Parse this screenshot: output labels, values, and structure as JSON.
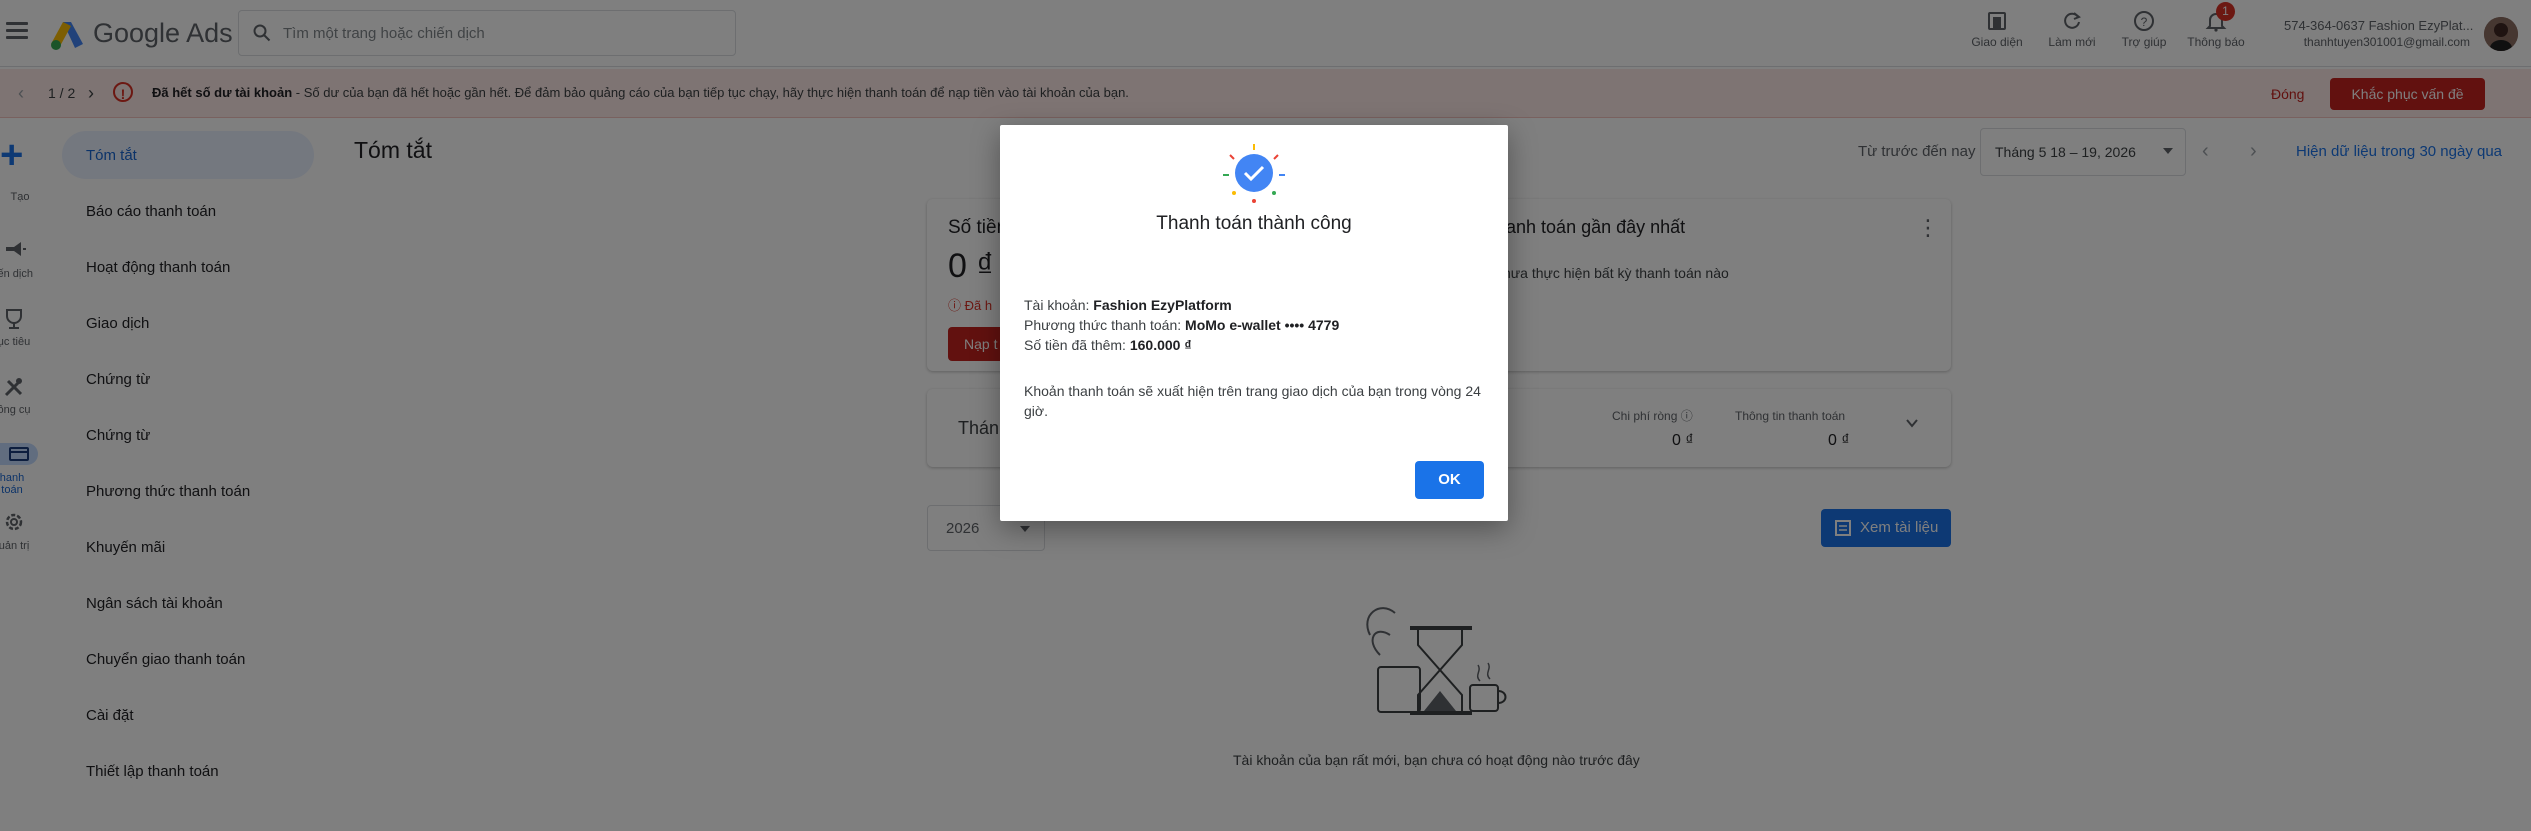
{
  "header": {
    "app_name": "Google Ads",
    "search_placeholder": "Tìm một trang hoặc chiến dịch",
    "tools": [
      {
        "label": "Giao diện",
        "icon": "appearance-icon"
      },
      {
        "label": "Làm mới",
        "icon": "refresh-icon"
      },
      {
        "label": "Trợ giúp",
        "icon": "help-icon"
      },
      {
        "label": "Thông báo",
        "icon": "bell-icon"
      }
    ],
    "notification_count": "1",
    "account_name": "574-364-0637 Fashion EzyPlat...",
    "account_email": "thanhtuyen301001@gmail.com"
  },
  "alert": {
    "pager": "1 / 2",
    "title": "Đã hết số dư tài khoản",
    "message": " - Số dư của bạn đã hết hoặc gần hết. Để đảm bảo quảng cáo của bạn tiếp tục chạy, hãy thực hiện thanh toán để nạp tiền vào tài khoản của bạn.",
    "dismiss_label": "Đóng",
    "fix_label": "Khắc phục vấn đề"
  },
  "rail": {
    "items": [
      {
        "label": "Tạo",
        "icon": "create-plus-icon"
      },
      {
        "label": "iến dịch",
        "icon": "campaign-icon"
      },
      {
        "label": "ục tiêu",
        "icon": "goal-icon"
      },
      {
        "label": "ông cụ",
        "icon": "tools-icon"
      },
      {
        "label": "hanh toán",
        "icon": "billing-icon"
      },
      {
        "label": "uản trị",
        "icon": "admin-icon"
      }
    ]
  },
  "sidenav": {
    "items": [
      "Tóm tắt",
      "Báo cáo thanh toán",
      "Hoạt động thanh toán",
      "Giao dịch",
      "Chứng từ",
      "Chứng từ",
      "Phương thức thanh toán",
      "Khuyến mãi",
      "Ngân sách tài khoản",
      "Chuyển giao thanh toán",
      "Cài đặt",
      "Thiết lập thanh toán"
    ],
    "active_index": 0
  },
  "main": {
    "title": "Tóm tắt",
    "date_label": "Từ trước đến nay",
    "date_range": "Tháng 5 18 – 19, 2026",
    "date_link": "Hiện dữ liệu trong 30 ngày qua",
    "balance_title": "Số tiền",
    "balance_amount": "0 ₫",
    "balance_warning": "Đã h",
    "balance_button": "Nạp t",
    "recent_title": "hanh toán gần đây nhất",
    "recent_text": "hưa thực hiện bất kỳ thanh toán nào",
    "summary_title": "Thán",
    "net_cost_label": "Chi phí ròng",
    "net_cost_value": "0 ₫",
    "pay_info_label": "Thông tin thanh toán",
    "pay_info_value": "0 ₫",
    "year": "2026",
    "docs_button": "Xem tài liệu",
    "empty_text": "Tài khoản của bạn rất mới, bạn chưa có hoạt động nào trước đây"
  },
  "dialog": {
    "title": "Thanh toán thành công",
    "account_label": "Tài khoản: ",
    "account_value": "Fashion EzyPlatform",
    "method_label": "Phương thức thanh toán: ",
    "method_value": "MoMo e-wallet •••• 4779",
    "amount_label": "Số tiền đã thêm: ",
    "amount_value": "160.000 ₫",
    "note": "Khoản thanh toán sẽ xuất hiện trên trang giao dịch của bạn trong vòng 24 giờ.",
    "ok_label": "OK"
  },
  "colors": {
    "primary": "#1a73e8",
    "error": "#c5221f",
    "nav_active_bg": "#e8f0fe"
  }
}
